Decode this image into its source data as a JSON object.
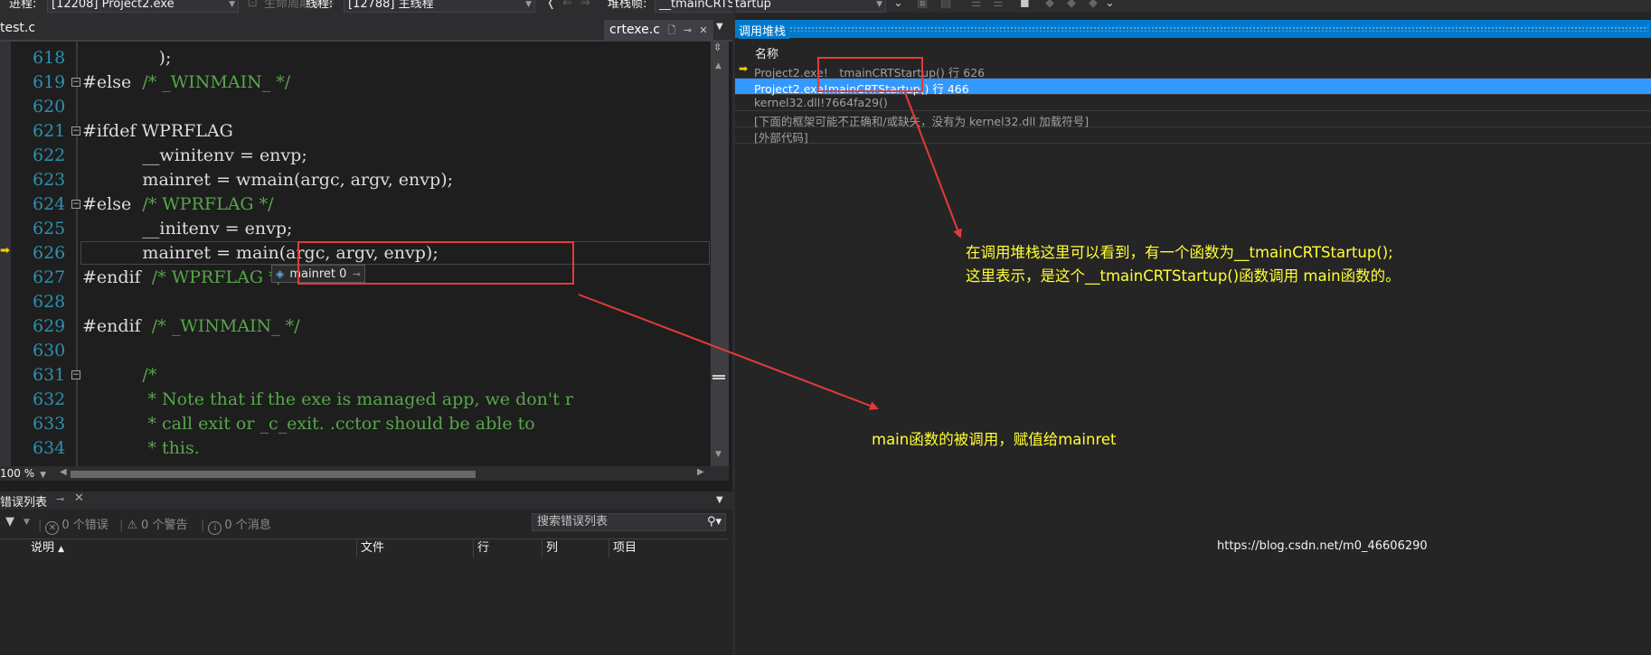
{
  "toolbar": {
    "process_label": "进程:",
    "process_value": "[12208] Project2.exe",
    "lifecycle_label": "生命周期事件",
    "thread_label": "线程:",
    "thread_value": "[12788] 主线程",
    "stackframe_label": "堆栈帧:",
    "stackframe_value": "__tmainCRTStartup"
  },
  "editor": {
    "tab_left": "test.c",
    "tab_active": "crtexe.c",
    "zoom": "100 %",
    "lines": [
      {
        "num": "618",
        "code": "              );"
      },
      {
        "num": "619",
        "code": "#else  ",
        "comment": "/* _WINMAIN_ */"
      },
      {
        "num": "620",
        "code": ""
      },
      {
        "num": "621",
        "code": "#ifdef WPRFLAG"
      },
      {
        "num": "622",
        "code": "           __winitenv = envp;"
      },
      {
        "num": "623",
        "code": "           mainret = wmain(argc, argv, envp);"
      },
      {
        "num": "624",
        "code": "#else  ",
        "comment": "/* WPRFLAG */"
      },
      {
        "num": "625",
        "code": "           __initenv = envp;"
      },
      {
        "num": "626",
        "code": "           mainret = main(argc, argv, envp);"
      },
      {
        "num": "627",
        "code": "#endif  ",
        "comment": "/* WPRFLAG */"
      },
      {
        "num": "628",
        "code": ""
      },
      {
        "num": "629",
        "code": "#endif  ",
        "comment": "/* _WINMAIN_ */"
      },
      {
        "num": "630",
        "code": ""
      },
      {
        "num": "631",
        "code": "",
        "comment": "           /*"
      },
      {
        "num": "632",
        "code": "",
        "comment": "            * Note that if the exe is managed app, we don't r"
      },
      {
        "num": "633",
        "code": "",
        "comment": "            * call exit or _c_exit. .cctor should be able to"
      },
      {
        "num": "634",
        "code": "",
        "comment": "            * this."
      }
    ],
    "datatip": "mainret 0"
  },
  "error_list": {
    "title": "错误列表",
    "errors": "0 个错误",
    "warnings": "0 个警告",
    "messages": "0 个消息",
    "search_placeholder": "搜索错误列表",
    "columns": [
      "说明",
      "文件",
      "行",
      "列",
      "项目"
    ]
  },
  "call_stack": {
    "title": "调用堆栈",
    "column": "名称",
    "rows": [
      {
        "text": "Project2.exe!__tmainCRTStartup() 行 626",
        "current": true,
        "selected": false
      },
      {
        "text": "Project2.exe!mainCRTStartup() 行 466",
        "current": false,
        "selected": true
      },
      {
        "text": "kernel32.dll!7664fa29()",
        "current": false,
        "selected": false
      },
      {
        "text": "[下面的框架可能不正确和/或缺失，没有为 kernel32.dll 加载符号]",
        "current": false,
        "selected": false
      },
      {
        "text": "[外部代码]",
        "current": false,
        "selected": false
      }
    ]
  },
  "annotations": {
    "callstack_note_line1": "在调用堆栈这里可以看到，有一个函数为__tmainCRTStartup();",
    "callstack_note_line2": "这里表示，是这个__tmainCRTStartup()函数调用 main函数的。",
    "main_note": "main函数的被调用，赋值给mainret",
    "annotation_color": "#ffff33",
    "highlight_color": "#e53a3a"
  },
  "watermark": "https://blog.csdn.net/m0_46606290"
}
